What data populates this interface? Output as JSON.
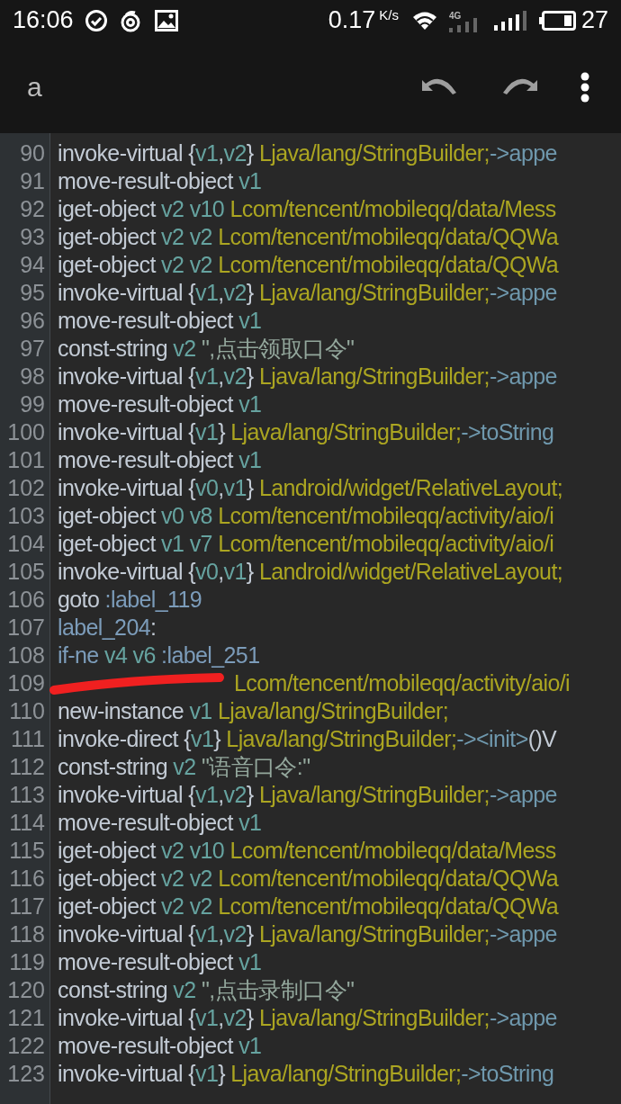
{
  "status_bar": {
    "time": "16:06",
    "speed": "0.17",
    "speed_unit": "K/s",
    "network": "4G",
    "battery_text": "27"
  },
  "app_bar": {
    "title": "a"
  },
  "lines": [
    {
      "number": "90",
      "marked": false,
      "tokens": [
        {
          "kind": "op",
          "text": "invoke-virtual "
        },
        {
          "kind": "op",
          "text": "{"
        },
        {
          "kind": "reg",
          "text": "v1"
        },
        {
          "kind": "op",
          "text": ","
        },
        {
          "kind": "reg",
          "text": "v2"
        },
        {
          "kind": "op",
          "text": "} "
        },
        {
          "kind": "type",
          "text": "Ljava/lang/StringBuilder;"
        },
        {
          "kind": "method",
          "text": "->appe"
        }
      ]
    },
    {
      "number": "91",
      "marked": false,
      "tokens": [
        {
          "kind": "op",
          "text": "move-result-object "
        },
        {
          "kind": "reg",
          "text": "v1"
        }
      ]
    },
    {
      "number": "92",
      "marked": false,
      "tokens": [
        {
          "kind": "op",
          "text": "iget-object "
        },
        {
          "kind": "reg",
          "text": "v2 v10 "
        },
        {
          "kind": "type",
          "text": "Lcom/tencent/mobileqq/data/Mess"
        }
      ]
    },
    {
      "number": "93",
      "marked": false,
      "tokens": [
        {
          "kind": "op",
          "text": "iget-object "
        },
        {
          "kind": "reg",
          "text": "v2 v2 "
        },
        {
          "kind": "type",
          "text": "Lcom/tencent/mobileqq/data/QQWa"
        }
      ]
    },
    {
      "number": "94",
      "marked": false,
      "tokens": [
        {
          "kind": "op",
          "text": "iget-object "
        },
        {
          "kind": "reg",
          "text": "v2 v2 "
        },
        {
          "kind": "type",
          "text": "Lcom/tencent/mobileqq/data/QQWa"
        }
      ]
    },
    {
      "number": "95",
      "marked": false,
      "tokens": [
        {
          "kind": "op",
          "text": "invoke-virtual "
        },
        {
          "kind": "op",
          "text": "{"
        },
        {
          "kind": "reg",
          "text": "v1"
        },
        {
          "kind": "op",
          "text": ","
        },
        {
          "kind": "reg",
          "text": "v2"
        },
        {
          "kind": "op",
          "text": "} "
        },
        {
          "kind": "type",
          "text": "Ljava/lang/StringBuilder;"
        },
        {
          "kind": "method",
          "text": "->appe"
        }
      ]
    },
    {
      "number": "96",
      "marked": false,
      "tokens": [
        {
          "kind": "op",
          "text": "move-result-object "
        },
        {
          "kind": "reg",
          "text": "v1"
        }
      ]
    },
    {
      "number": "97",
      "marked": false,
      "tokens": [
        {
          "kind": "op",
          "text": "const-string "
        },
        {
          "kind": "reg",
          "text": "v2 "
        },
        {
          "kind": "string",
          "text": "\",点击领取口令\""
        }
      ]
    },
    {
      "number": "98",
      "marked": false,
      "tokens": [
        {
          "kind": "op",
          "text": "invoke-virtual "
        },
        {
          "kind": "op",
          "text": "{"
        },
        {
          "kind": "reg",
          "text": "v1"
        },
        {
          "kind": "op",
          "text": ","
        },
        {
          "kind": "reg",
          "text": "v2"
        },
        {
          "kind": "op",
          "text": "} "
        },
        {
          "kind": "type",
          "text": "Ljava/lang/StringBuilder;"
        },
        {
          "kind": "method",
          "text": "->appe"
        }
      ]
    },
    {
      "number": "99",
      "marked": false,
      "tokens": [
        {
          "kind": "op",
          "text": "move-result-object "
        },
        {
          "kind": "reg",
          "text": "v1"
        }
      ]
    },
    {
      "number": "100",
      "marked": false,
      "tokens": [
        {
          "kind": "op",
          "text": "invoke-virtual "
        },
        {
          "kind": "op",
          "text": "{"
        },
        {
          "kind": "reg",
          "text": "v1"
        },
        {
          "kind": "op",
          "text": "} "
        },
        {
          "kind": "type",
          "text": "Ljava/lang/StringBuilder;"
        },
        {
          "kind": "method",
          "text": "->toString"
        }
      ]
    },
    {
      "number": "101",
      "marked": false,
      "tokens": [
        {
          "kind": "op",
          "text": "move-result-object "
        },
        {
          "kind": "reg",
          "text": "v1"
        }
      ]
    },
    {
      "number": "102",
      "marked": false,
      "tokens": [
        {
          "kind": "op",
          "text": "invoke-virtual "
        },
        {
          "kind": "op",
          "text": "{"
        },
        {
          "kind": "reg",
          "text": "v0"
        },
        {
          "kind": "op",
          "text": ","
        },
        {
          "kind": "reg",
          "text": "v1"
        },
        {
          "kind": "op",
          "text": "} "
        },
        {
          "kind": "type",
          "text": "Landroid/widget/RelativeLayout;"
        }
      ]
    },
    {
      "number": "103",
      "marked": false,
      "tokens": [
        {
          "kind": "op",
          "text": "iget-object "
        },
        {
          "kind": "reg",
          "text": "v0 v8 "
        },
        {
          "kind": "type",
          "text": "Lcom/tencent/mobileqq/activity/aio/i"
        }
      ]
    },
    {
      "number": "104",
      "marked": false,
      "tokens": [
        {
          "kind": "op",
          "text": "iget-object "
        },
        {
          "kind": "reg",
          "text": "v1 v7 "
        },
        {
          "kind": "type",
          "text": "Lcom/tencent/mobileqq/activity/aio/i"
        }
      ]
    },
    {
      "number": "105",
      "marked": false,
      "tokens": [
        {
          "kind": "op",
          "text": "invoke-virtual "
        },
        {
          "kind": "op",
          "text": "{"
        },
        {
          "kind": "reg",
          "text": "v0"
        },
        {
          "kind": "op",
          "text": ","
        },
        {
          "kind": "reg",
          "text": "v1"
        },
        {
          "kind": "op",
          "text": "} "
        },
        {
          "kind": "type",
          "text": "Landroid/widget/RelativeLayout;"
        }
      ]
    },
    {
      "number": "106",
      "marked": false,
      "tokens": [
        {
          "kind": "op",
          "text": "goto "
        },
        {
          "kind": "label",
          "text": ":label_119"
        }
      ]
    },
    {
      "number": "107",
      "marked": false,
      "tokens": [
        {
          "kind": "label",
          "text": "label_204"
        },
        {
          "kind": "op",
          "text": ":"
        }
      ]
    },
    {
      "number": "108",
      "marked": false,
      "tokens": [
        {
          "kind": "label",
          "text": "if-ne "
        },
        {
          "kind": "reg",
          "text": "v4 v6 "
        },
        {
          "kind": "label",
          "text": ":label_251"
        }
      ]
    },
    {
      "number": "109",
      "marked": true,
      "tokens": [
        {
          "kind": "type",
          "text": "Lcom/tencent/mobileqq/activity/aio/i"
        }
      ]
    },
    {
      "number": "110",
      "marked": false,
      "tokens": [
        {
          "kind": "op",
          "text": "new-instance "
        },
        {
          "kind": "reg",
          "text": "v1 "
        },
        {
          "kind": "type",
          "text": "Ljava/lang/StringBuilder;"
        }
      ]
    },
    {
      "number": "111",
      "marked": false,
      "tokens": [
        {
          "kind": "op",
          "text": "invoke-direct "
        },
        {
          "kind": "op",
          "text": "{"
        },
        {
          "kind": "reg",
          "text": "v1"
        },
        {
          "kind": "op",
          "text": "} "
        },
        {
          "kind": "type",
          "text": "Ljava/lang/StringBuilder;"
        },
        {
          "kind": "method",
          "text": "-><init>"
        },
        {
          "kind": "op",
          "text": "()V"
        }
      ]
    },
    {
      "number": "112",
      "marked": false,
      "tokens": [
        {
          "kind": "op",
          "text": "const-string "
        },
        {
          "kind": "reg",
          "text": "v2 "
        },
        {
          "kind": "string",
          "text": "\"语音口令:\""
        }
      ]
    },
    {
      "number": "113",
      "marked": false,
      "tokens": [
        {
          "kind": "op",
          "text": "invoke-virtual "
        },
        {
          "kind": "op",
          "text": "{"
        },
        {
          "kind": "reg",
          "text": "v1"
        },
        {
          "kind": "op",
          "text": ","
        },
        {
          "kind": "reg",
          "text": "v2"
        },
        {
          "kind": "op",
          "text": "} "
        },
        {
          "kind": "type",
          "text": "Ljava/lang/StringBuilder;"
        },
        {
          "kind": "method",
          "text": "->appe"
        }
      ]
    },
    {
      "number": "114",
      "marked": false,
      "tokens": [
        {
          "kind": "op",
          "text": "move-result-object "
        },
        {
          "kind": "reg",
          "text": "v1"
        }
      ]
    },
    {
      "number": "115",
      "marked": false,
      "tokens": [
        {
          "kind": "op",
          "text": "iget-object "
        },
        {
          "kind": "reg",
          "text": "v2 v10 "
        },
        {
          "kind": "type",
          "text": "Lcom/tencent/mobileqq/data/Mess"
        }
      ]
    },
    {
      "number": "116",
      "marked": false,
      "tokens": [
        {
          "kind": "op",
          "text": "iget-object "
        },
        {
          "kind": "reg",
          "text": "v2 v2 "
        },
        {
          "kind": "type",
          "text": "Lcom/tencent/mobileqq/data/QQWa"
        }
      ]
    },
    {
      "number": "117",
      "marked": false,
      "tokens": [
        {
          "kind": "op",
          "text": "iget-object "
        },
        {
          "kind": "reg",
          "text": "v2 v2 "
        },
        {
          "kind": "type",
          "text": "Lcom/tencent/mobileqq/data/QQWa"
        }
      ]
    },
    {
      "number": "118",
      "marked": false,
      "tokens": [
        {
          "kind": "op",
          "text": "invoke-virtual "
        },
        {
          "kind": "op",
          "text": "{"
        },
        {
          "kind": "reg",
          "text": "v1"
        },
        {
          "kind": "op",
          "text": ","
        },
        {
          "kind": "reg",
          "text": "v2"
        },
        {
          "kind": "op",
          "text": "} "
        },
        {
          "kind": "type",
          "text": "Ljava/lang/StringBuilder;"
        },
        {
          "kind": "method",
          "text": "->appe"
        }
      ]
    },
    {
      "number": "119",
      "marked": false,
      "tokens": [
        {
          "kind": "op",
          "text": "move-result-object "
        },
        {
          "kind": "reg",
          "text": "v1"
        }
      ]
    },
    {
      "number": "120",
      "marked": false,
      "tokens": [
        {
          "kind": "op",
          "text": "const-string "
        },
        {
          "kind": "reg",
          "text": "v2 "
        },
        {
          "kind": "string",
          "text": "\",点击录制口令\""
        }
      ]
    },
    {
      "number": "121",
      "marked": false,
      "tokens": [
        {
          "kind": "op",
          "text": "invoke-virtual "
        },
        {
          "kind": "op",
          "text": "{"
        },
        {
          "kind": "reg",
          "text": "v1"
        },
        {
          "kind": "op",
          "text": ","
        },
        {
          "kind": "reg",
          "text": "v2"
        },
        {
          "kind": "op",
          "text": "} "
        },
        {
          "kind": "type",
          "text": "Ljava/lang/StringBuilder;"
        },
        {
          "kind": "method",
          "text": "->appe"
        }
      ]
    },
    {
      "number": "122",
      "marked": false,
      "tokens": [
        {
          "kind": "op",
          "text": "move-result-object "
        },
        {
          "kind": "reg",
          "text": "v1"
        }
      ]
    },
    {
      "number": "123",
      "marked": false,
      "tokens": [
        {
          "kind": "op",
          "text": "invoke-virtual "
        },
        {
          "kind": "op",
          "text": "{"
        },
        {
          "kind": "reg",
          "text": "v1"
        },
        {
          "kind": "op",
          "text": "} "
        },
        {
          "kind": "type",
          "text": "Ljava/lang/StringBuilder;"
        },
        {
          "kind": "method",
          "text": "->toString"
        }
      ]
    }
  ]
}
